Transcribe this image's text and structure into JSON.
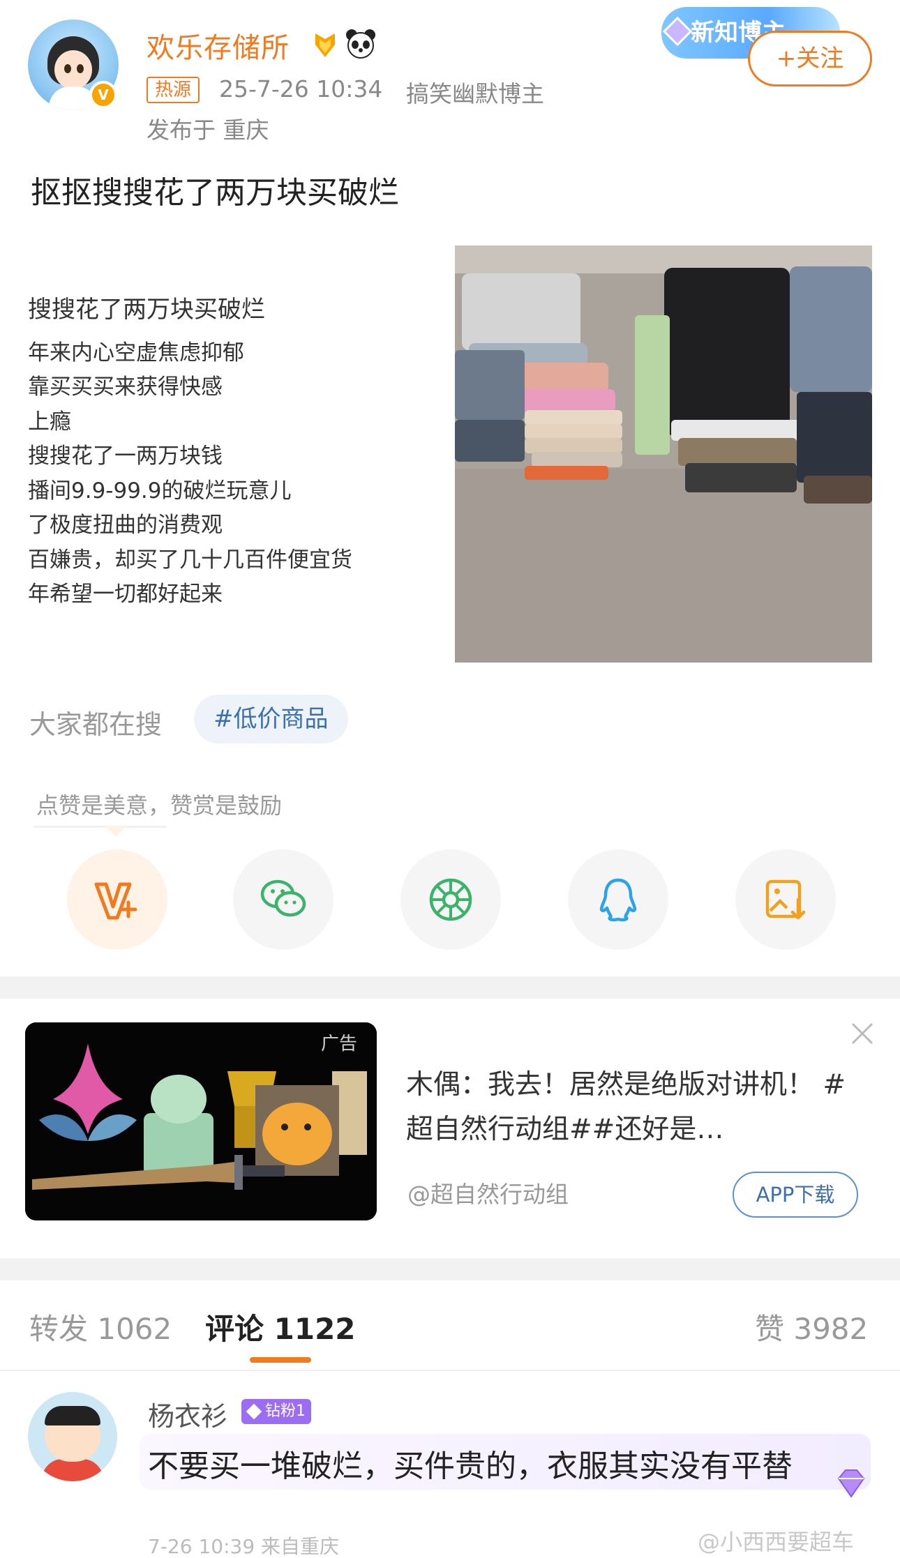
{
  "header": {
    "username": "欢乐存储所",
    "hot_tag": "热源",
    "time": "25-7-26 10:34",
    "blogger_type": "搞笑幽默博主",
    "location": "发布于 重庆",
    "badge_text": "新知博主",
    "follow_label": "+关注",
    "accent_color": "#f07a1e"
  },
  "post": {
    "title": "抠抠搜搜花了两万块买破烂",
    "card_lines": [
      "搜搜花了两万块买破烂",
      "年来内心空虚焦虑抑郁",
      "靠买买买来获得快感",
      "上瘾",
      "搜搜花了一两万块钱",
      "播间9.9-99.9的破烂玩意儿",
      "了极度扭曲的消费观",
      "百嫌贵，却买了几十几百件便宜货",
      "年希望一切都好起来"
    ],
    "search_label": "大家都在搜",
    "topic": "#低价商品",
    "reward_hint": "点赞是美意，赞赏是鼓励"
  },
  "share": [
    {
      "icon": "reward-v-icon",
      "color": "#f07a1e"
    },
    {
      "icon": "wechat-icon",
      "color": "#3bb36b"
    },
    {
      "icon": "moments-icon",
      "color": "#3bb36b"
    },
    {
      "icon": "qq-icon",
      "color": "#2aa3e8"
    },
    {
      "icon": "save-image-icon",
      "color": "#f0a21e"
    }
  ],
  "ad": {
    "label": "广告",
    "text": "木偶：我去！居然是绝版对讲机！ #超自然行动组##还好是…",
    "source": "@超自然行动组",
    "download": "APP下载"
  },
  "tabs": {
    "repost": "转发 1062",
    "comment": "评论 1122",
    "like": "赞 3982"
  },
  "comment": {
    "name": "杨衣衫",
    "fan_badge": "钻粉1",
    "text": "不要买一堆破烂，买件贵的，衣服其实没有平替",
    "meta": "7-26 10:39 来自重庆"
  },
  "watermark": "@小西西要超车"
}
